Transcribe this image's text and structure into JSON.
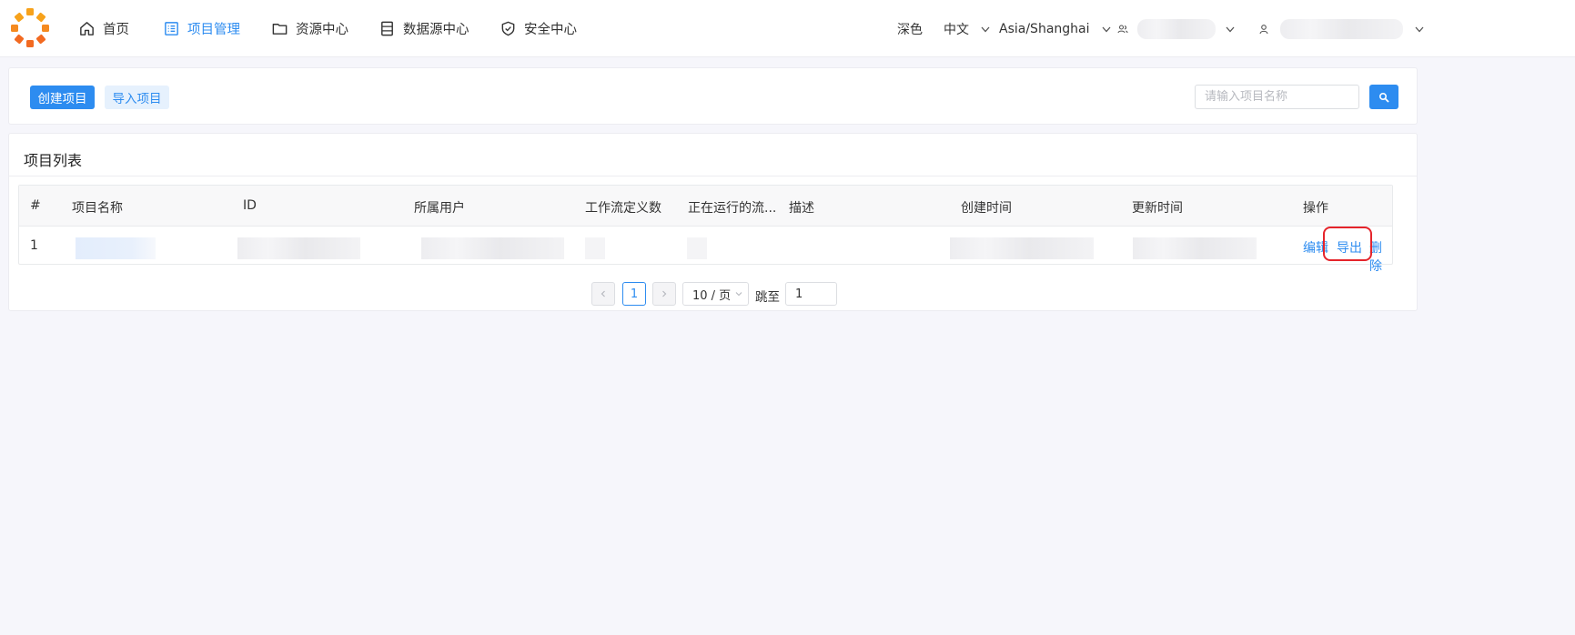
{
  "nav": {
    "items": [
      {
        "label": "首页",
        "icon": "home-icon"
      },
      {
        "label": "项目管理",
        "icon": "project-list-icon",
        "active": true
      },
      {
        "label": "资源中心",
        "icon": "folder-icon"
      },
      {
        "label": "数据源中心",
        "icon": "datasource-icon"
      },
      {
        "label": "安全中心",
        "icon": "shield-icon"
      }
    ],
    "theme_label": "深色",
    "language_label": "中文",
    "timezone_label": "Asia/Shanghai",
    "accent_color": "#2d8cf0"
  },
  "toolbar": {
    "create_label": "创建项目",
    "import_label": "导入项目",
    "search_placeholder": "请输入项目名称"
  },
  "project_list": {
    "title": "项目列表",
    "columns": [
      "#",
      "项目名称",
      "ID",
      "所属用户",
      "工作流定义数",
      "正在运行的流...",
      "描述",
      "创建时间",
      "更新时间",
      "操作"
    ],
    "rows": [
      {
        "index": "1",
        "actions": {
          "edit": "编辑",
          "export": "导出",
          "delete": "删除"
        }
      }
    ]
  },
  "pagination": {
    "current_page": "1",
    "page_size_label": "10 / 页",
    "jump_label": "跳至",
    "jump_value": "1"
  }
}
